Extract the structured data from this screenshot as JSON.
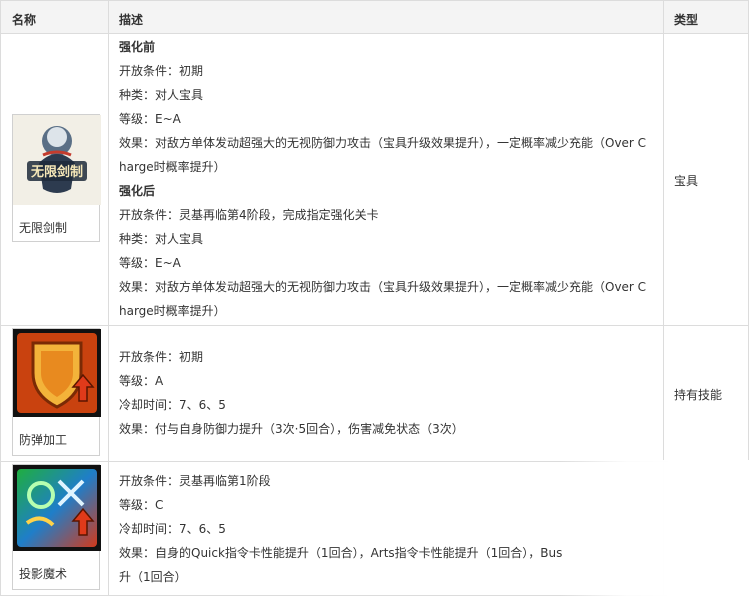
{
  "header": {
    "name": "名称",
    "description": "描述",
    "type": "类型"
  },
  "rows": [
    {
      "name": "无限剑制",
      "icon": "unlimited-blade-works-icon",
      "type": "宝具",
      "lines": [
        "强化前",
        "开放条件：初期",
        "种类：对人宝具",
        "等级：E~A",
        "效果：对敌方单体发动超强大的无视防御力攻击（宝具升级效果提升），一定概率减少充能（Over C",
        "harge时概率提升）",
        "强化后",
        "开放条件：灵基再临第4阶段，完成指定强化关卡",
        "种类：对人宝具",
        "等级：E~A",
        "效果：对敌方单体发动超强大的无视防御力攻击（宝具升级效果提升），一定概率减少充能（Over C",
        "harge时概率提升）"
      ]
    },
    {
      "name": "防弹加工",
      "icon": "shield-up-icon",
      "type": "持有技能",
      "lines": [
        "开放条件：初期",
        "等级：A",
        "冷却时间：7、6、5",
        "效果：付与自身防御力提升（3次·5回合），伤害减免状态（3次）"
      ]
    },
    {
      "name": "投影魔术",
      "icon": "projection-magic-icon",
      "type": "",
      "lines": [
        "开放条件：灵基再临第1阶段",
        "等级：C",
        "冷却时间：7、6、5",
        "效果：自身的Quick指令卡性能提升（1回合），Arts指令卡性能提升（1回合），Bus",
        "升（1回合）"
      ]
    }
  ],
  "colors": {
    "header_bg": "#f4f4f4",
    "border": "#dcdcdc",
    "text": "#333333"
  }
}
